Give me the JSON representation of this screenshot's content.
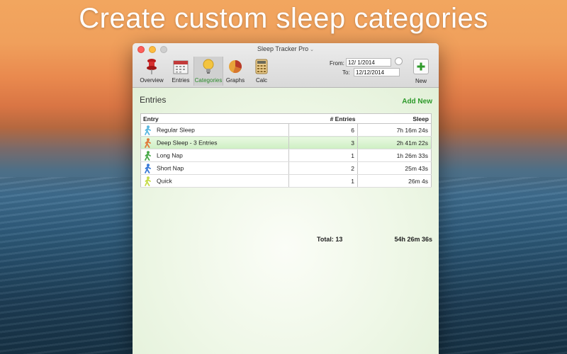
{
  "headline": "Create custom sleep categories",
  "window": {
    "title": "Sleep Tracker Pro"
  },
  "toolbar": {
    "items": [
      {
        "label": "Overview",
        "icon": "pushpin-icon"
      },
      {
        "label": "Entries",
        "icon": "calendar-icon"
      },
      {
        "label": "Categories",
        "icon": "lightbulb-icon",
        "active": true
      },
      {
        "label": "Graphs",
        "icon": "pie-chart-icon"
      },
      {
        "label": "Calc",
        "icon": "calculator-icon"
      }
    ],
    "from_label": "From:",
    "from_value": "12/ 1/2014",
    "to_label": "To:",
    "to_value": "12/12/2014",
    "new_label": "New"
  },
  "main": {
    "title": "Entries",
    "add_new": "Add New",
    "columns": [
      "Entry",
      "# Entries",
      "Sleep"
    ],
    "rows": [
      {
        "name": "Regular Sleep",
        "count": "6",
        "sleep": "7h 16m 24s",
        "color": "#5ab8e0"
      },
      {
        "name": "Deep Sleep - 3 Entries",
        "count": "3",
        "sleep": "2h 41m 22s",
        "color": "#e07a3a",
        "selected": true
      },
      {
        "name": "Long Nap",
        "count": "1",
        "sleep": "1h 26m 33s",
        "color": "#4aaa4a"
      },
      {
        "name": "Short Nap",
        "count": "2",
        "sleep": "25m 43s",
        "color": "#3a7ad8"
      },
      {
        "name": "Quick",
        "count": "1",
        "sleep": "26m 4s",
        "color": "#c6dc4a"
      }
    ],
    "total_count": "Total: 13",
    "total_sleep": "54h 26m 36s"
  },
  "colors": {
    "accent_green": "#2d9a2a",
    "content_bg": "#eef6e8"
  }
}
